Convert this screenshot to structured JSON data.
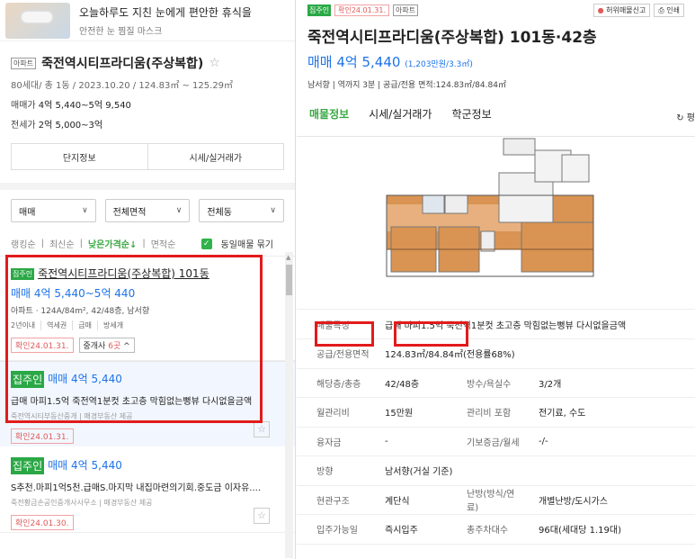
{
  "ad": {
    "title": "오늘하루도 지친 눈에게 편안한 휴식을",
    "subtitle": "안전한 눈 찜질 마스크"
  },
  "complex": {
    "type_tag": "아파트",
    "name": "죽전역시티프라디움(주상복합)",
    "meta": "80세대/ 총 1동 / 2023.10.20 / 124.83㎡ ~ 125.29㎡",
    "sale_label": "매매가",
    "sale_value": "4억 5,440~5억 9,540",
    "jeonse_label": "전세가",
    "jeonse_value": "2억 5,000~3억",
    "btn_info": "단지정보",
    "btn_market": "시세/실거래가"
  },
  "filters": {
    "deal": "매매",
    "area": "전체면적",
    "dong": "전체동"
  },
  "sort": {
    "items": [
      "랭킹순",
      "최신순",
      "낮은가격순↓",
      "면적순"
    ],
    "active_index": 2,
    "same_listing": "동일매물 묶기"
  },
  "listing1": {
    "badge": "집주인",
    "title": "죽전역시티프라디움(주상복합) 101동",
    "price": "매매 4억 5,440",
    "price_range": "~5억 440",
    "info": "아파트 · 124A/84m², 42/48층, 남서향",
    "chips": [
      "2년이내",
      "역세권",
      "급매",
      "방세개"
    ],
    "confirm": "확인24.01.31.",
    "agent_prefix": "중개사",
    "agent_count": "6곳",
    "agent_suffix": "^"
  },
  "listing1_sub": {
    "badge": "집주인",
    "price": "매매 4억 5,440",
    "desc": "급매 마피1.5억 죽전역1분컷 초고층 막힘없는뻥뷰 다시없을금액",
    "source": "죽전역시티부동산중개 | 매경부동산 제공",
    "confirm": "확인24.01.31."
  },
  "listing2": {
    "badge": "집주인",
    "price": "매매 4억 5,440",
    "desc": "S추천.마피1억5천.급매S.마지막 내집마련의기회.중도금 이자유....",
    "source": "죽전황금손공인중개사사무소 | 매경부동산 제공",
    "confirm": "확인24.01.30."
  },
  "detail": {
    "badge": "집주인",
    "confirm": "확인24.01.31.",
    "type_tag": "아파트",
    "tool_report": "허위매물신고",
    "tool_print": "인쇄",
    "title": "죽전역시티프라디움(주상복합) 101동·42층",
    "price": "매매 4억 5,440",
    "price_unit": "(1,203만원/3.3㎡)",
    "info": "남서향 | 역까지 3분 | 공급/전용 면적:124.83㎡/84.84㎡",
    "tabs": [
      "매물정보",
      "시세/실거래가",
      "학군정보"
    ],
    "tab_right": "평",
    "rows": [
      {
        "k": "매물특징",
        "v": "급매 마피1.5억 죽전역1분컷 초고층 막힘없는뻥뷰 다시없을금액",
        "k2": "",
        "v2": ""
      },
      {
        "k": "공급/전용면적",
        "v": "124.83㎡/84.84㎡(전용률68%)",
        "k2": "",
        "v2": ""
      },
      {
        "k": "해당층/총층",
        "v": "42/48층",
        "k2": "방수/욕실수",
        "v2": "3/2개"
      },
      {
        "k": "월관리비",
        "v": "15만원",
        "k2": "관리비 포함",
        "v2": "전기료, 수도"
      },
      {
        "k": "융자금",
        "v": "-",
        "k2": "기보증금/월세",
        "v2": "-/-"
      },
      {
        "k": "방향",
        "v": "남서향(거실 기준)",
        "k2": "",
        "v2": ""
      },
      {
        "k": "현관구조",
        "v": "계단식",
        "k2": "난방(방식/연료)",
        "v2": "개별난방/도시가스"
      },
      {
        "k": "입주가능일",
        "v": "즉시입주",
        "k2": "총주차대수",
        "v2": "96대(세대당 1.19대)"
      }
    ]
  }
}
